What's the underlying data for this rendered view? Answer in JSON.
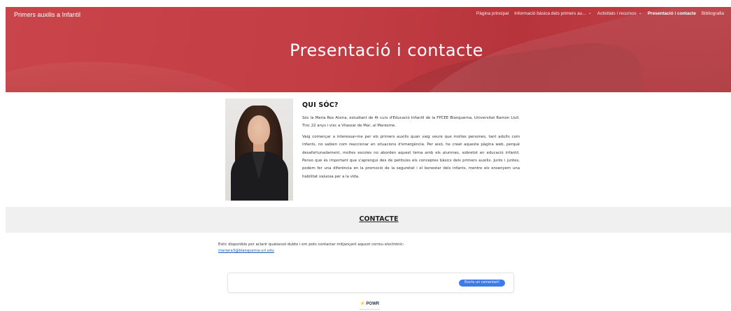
{
  "header": {
    "site_title": "Primers auxilis a Infantil",
    "nav": [
      {
        "label": "Pàgina principal",
        "dropdown": false,
        "active": false
      },
      {
        "label": "Informació bàsica dels primers au...",
        "dropdown": true,
        "active": false
      },
      {
        "label": "Activitats i recursos",
        "dropdown": true,
        "active": false
      },
      {
        "label": "Presentació i contacte",
        "dropdown": false,
        "active": true
      },
      {
        "label": "Bibliografia",
        "dropdown": false,
        "active": false
      }
    ],
    "hero_title": "Presentació i contacte",
    "hero_color": "#c23d44"
  },
  "about": {
    "title": "QUI SÓC?",
    "paragraphs": [
      "Sóc la Maria Ros Alsina, estudiant de 4t curs d'Educació Infantil de la FPCEE Blanquerna, Universitat Ramon Llull. Tinc 22 anys i visc a Vilassar de Mar, al Maresme.",
      "Vaig començar a interessar-me per els primers auxilis quan vaig veure que moltes persones, tant adults com infants, no sabien com reaccionar en situacions d'emergència. Per això, he creat aquesta pàgina web, perquè desafortunadament, moltes escoles no aborden aquest tema amb els alumnes, sobretot en educació infantil. Penso que és important que s'aprengui des de petits/es els conceptes bàsics dels primers auxilis. Junts i juntes, podem fer una diferència en la promoció de la seguretat i el benestar dels infants, mentre els ensenyem una habilitat valuosa per a la vida."
    ]
  },
  "contact": {
    "title": "CONTACTE",
    "text": "Estic disponible per aclarir qualsevol dubte i em pots contactar mitjançant aquest correu electrònic:",
    "email": "mariara3@blanquerna.url.edu"
  },
  "comments": {
    "button_label": "Escriu un comentari!",
    "button_color": "#3d7bea",
    "brand": "POWR"
  }
}
